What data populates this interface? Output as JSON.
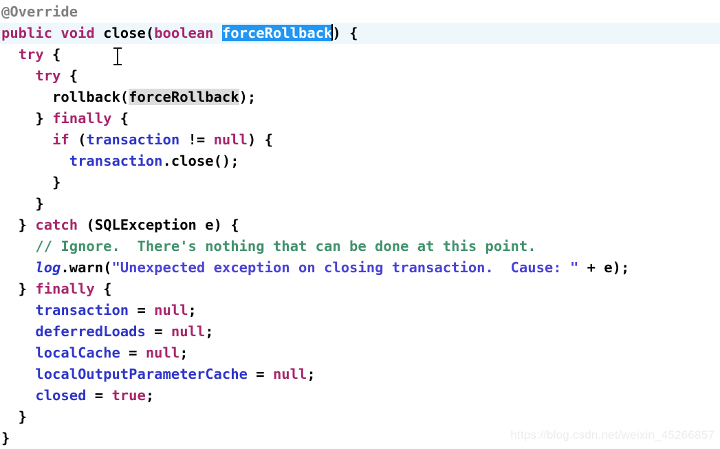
{
  "editor": {
    "language": "java",
    "background_color": "#ffffff",
    "current_line_highlight_color": "#eef7fc",
    "selection_color": "#2196f3",
    "occurrence_highlight_color": "#dcdcdc",
    "colors": {
      "annotation": "#808080",
      "keyword": "#a8246b",
      "field": "#2e35c9",
      "string": "#4a42d6",
      "comment": "#40916c",
      "plain": "#000000"
    },
    "caret_symbol": "|",
    "mouse_cursor_icon": "text-ibeam-cursor"
  },
  "code": {
    "lines": [
      {
        "id": "line-1",
        "current": false,
        "tokens": [
          {
            "t": "annotation",
            "v": "@Override"
          }
        ]
      },
      {
        "id": "line-2",
        "current": true,
        "tokens": [
          {
            "t": "keyword",
            "v": "public"
          },
          {
            "t": "plain",
            "v": " "
          },
          {
            "t": "keyword",
            "v": "void"
          },
          {
            "t": "plain",
            "v": " close("
          },
          {
            "t": "keyword",
            "v": "boolean"
          },
          {
            "t": "plain",
            "v": " "
          },
          {
            "t": "selected",
            "v": "forceRollback"
          },
          {
            "t": "caret",
            "v": ""
          },
          {
            "t": "plain",
            "v": ") {"
          }
        ]
      },
      {
        "id": "line-3",
        "current": false,
        "tokens": [
          {
            "t": "plain",
            "v": "  "
          },
          {
            "t": "keyword",
            "v": "try"
          },
          {
            "t": "plain",
            "v": " {"
          }
        ]
      },
      {
        "id": "line-4",
        "current": false,
        "tokens": [
          {
            "t": "plain",
            "v": "    "
          },
          {
            "t": "keyword",
            "v": "try"
          },
          {
            "t": "plain",
            "v": " {"
          }
        ]
      },
      {
        "id": "line-5",
        "current": false,
        "tokens": [
          {
            "t": "plain",
            "v": "      rollback("
          },
          {
            "t": "occurrence",
            "v": "forceRollback"
          },
          {
            "t": "plain",
            "v": ");"
          }
        ]
      },
      {
        "id": "line-6",
        "current": false,
        "tokens": [
          {
            "t": "plain",
            "v": "    } "
          },
          {
            "t": "keyword",
            "v": "finally"
          },
          {
            "t": "plain",
            "v": " {"
          }
        ]
      },
      {
        "id": "line-7",
        "current": false,
        "tokens": [
          {
            "t": "plain",
            "v": "      "
          },
          {
            "t": "keyword",
            "v": "if"
          },
          {
            "t": "plain",
            "v": " ("
          },
          {
            "t": "field",
            "v": "transaction"
          },
          {
            "t": "plain",
            "v": " != "
          },
          {
            "t": "keyword",
            "v": "null"
          },
          {
            "t": "plain",
            "v": ") {"
          }
        ]
      },
      {
        "id": "line-8",
        "current": false,
        "tokens": [
          {
            "t": "plain",
            "v": "        "
          },
          {
            "t": "field",
            "v": "transaction"
          },
          {
            "t": "plain",
            "v": ".close();"
          }
        ]
      },
      {
        "id": "line-9",
        "current": false,
        "tokens": [
          {
            "t": "plain",
            "v": "      }"
          }
        ]
      },
      {
        "id": "line-10",
        "current": false,
        "tokens": [
          {
            "t": "plain",
            "v": "    }"
          }
        ]
      },
      {
        "id": "line-11",
        "current": false,
        "tokens": [
          {
            "t": "plain",
            "v": "  } "
          },
          {
            "t": "keyword",
            "v": "catch"
          },
          {
            "t": "plain",
            "v": " (SQLException e) {"
          }
        ]
      },
      {
        "id": "line-12",
        "current": false,
        "tokens": [
          {
            "t": "plain",
            "v": "    "
          },
          {
            "t": "comment",
            "v": "// Ignore.  There's nothing that can be done at this point."
          }
        ]
      },
      {
        "id": "line-13",
        "current": false,
        "tokens": [
          {
            "t": "plain",
            "v": "    "
          },
          {
            "t": "static",
            "v": "log"
          },
          {
            "t": "plain",
            "v": ".warn("
          },
          {
            "t": "string",
            "v": "\"Unexpected exception on closing transaction.  Cause: \""
          },
          {
            "t": "plain",
            "v": " + e);"
          }
        ]
      },
      {
        "id": "line-14",
        "current": false,
        "tokens": [
          {
            "t": "plain",
            "v": "  } "
          },
          {
            "t": "keyword",
            "v": "finally"
          },
          {
            "t": "plain",
            "v": " {"
          }
        ]
      },
      {
        "id": "line-15",
        "current": false,
        "tokens": [
          {
            "t": "plain",
            "v": "    "
          },
          {
            "t": "field",
            "v": "transaction"
          },
          {
            "t": "plain",
            "v": " = "
          },
          {
            "t": "keyword",
            "v": "null"
          },
          {
            "t": "plain",
            "v": ";"
          }
        ]
      },
      {
        "id": "line-16",
        "current": false,
        "tokens": [
          {
            "t": "plain",
            "v": "    "
          },
          {
            "t": "field",
            "v": "deferredLoads"
          },
          {
            "t": "plain",
            "v": " = "
          },
          {
            "t": "keyword",
            "v": "null"
          },
          {
            "t": "plain",
            "v": ";"
          }
        ]
      },
      {
        "id": "line-17",
        "current": false,
        "tokens": [
          {
            "t": "plain",
            "v": "    "
          },
          {
            "t": "field",
            "v": "localCache"
          },
          {
            "t": "plain",
            "v": " = "
          },
          {
            "t": "keyword",
            "v": "null"
          },
          {
            "t": "plain",
            "v": ";"
          }
        ]
      },
      {
        "id": "line-18",
        "current": false,
        "tokens": [
          {
            "t": "plain",
            "v": "    "
          },
          {
            "t": "field",
            "v": "localOutputParameterCache"
          },
          {
            "t": "plain",
            "v": " = "
          },
          {
            "t": "keyword",
            "v": "null"
          },
          {
            "t": "plain",
            "v": ";"
          }
        ]
      },
      {
        "id": "line-19",
        "current": false,
        "tokens": [
          {
            "t": "plain",
            "v": "    "
          },
          {
            "t": "field",
            "v": "closed"
          },
          {
            "t": "plain",
            "v": " = "
          },
          {
            "t": "keyword",
            "v": "true"
          },
          {
            "t": "plain",
            "v": ";"
          }
        ]
      },
      {
        "id": "line-20",
        "current": false,
        "tokens": [
          {
            "t": "plain",
            "v": "  }"
          }
        ]
      },
      {
        "id": "line-21",
        "current": false,
        "tokens": [
          {
            "t": "plain",
            "v": "}"
          }
        ]
      }
    ]
  },
  "watermark": {
    "text": "https://blog.csdn.net/weixin_45266857"
  }
}
